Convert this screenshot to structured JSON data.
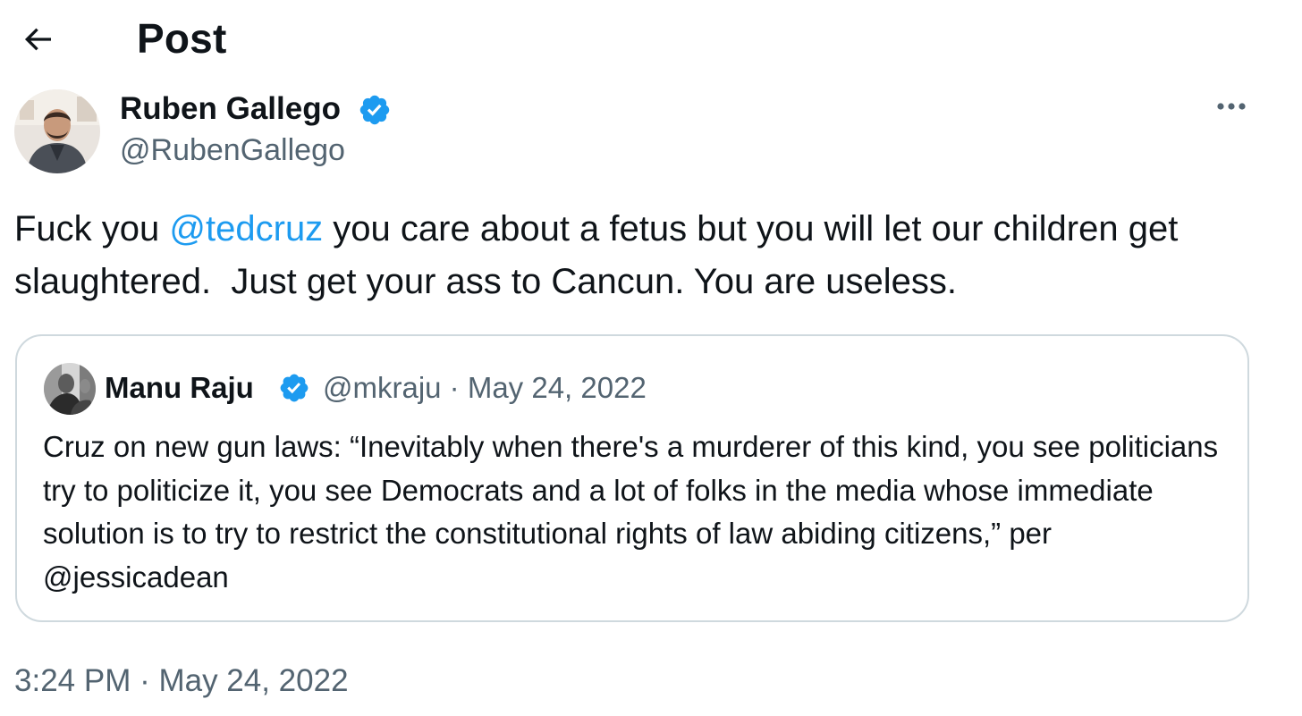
{
  "header": {
    "title": "Post",
    "back_icon": "arrow-left-icon"
  },
  "post": {
    "author": {
      "name": "Ruben Gallego",
      "handle": "@RubenGallego",
      "verified": true
    },
    "text": {
      "before_mention": "Fuck you ",
      "mention": "@tedcruz",
      "after_mention": " you care about a fetus but you will let our children get slaughtered.  Just get your ass to Cancun. You are useless."
    },
    "timestamp": "3:24 PM · May 24, 2022"
  },
  "quoted_post": {
    "author": {
      "name": "Manu Raju",
      "handle": "@mkraju",
      "verified": true
    },
    "meta": "@mkraju · May 24, 2022",
    "text": "Cruz on new gun laws: “Inevitably when there's a murderer of this kind, you see politicians try to politicize it, you see Democrats and a lot of folks in the media whose immediate solution is to try to restrict the constitutional rights of law abiding citizens,” per @jessicadean"
  },
  "colors": {
    "text": "#0f1419",
    "secondary": "#536471",
    "accent": "#1d9bf0",
    "border": "#cfd9de"
  }
}
